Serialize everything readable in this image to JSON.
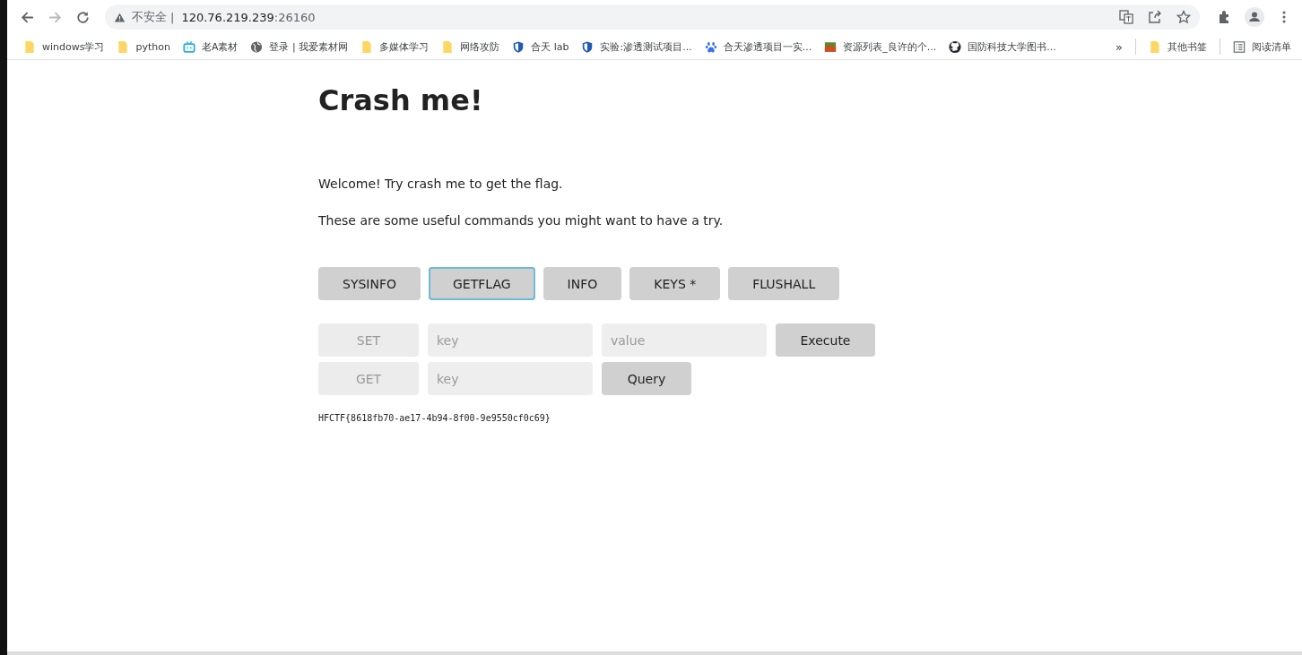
{
  "address_bar": {
    "security_label": "不安全",
    "separator": "|",
    "host": "120.76.219.239",
    "port": ":26160"
  },
  "bookmarks": [
    {
      "kind": "folder",
      "label": "windows学习"
    },
    {
      "kind": "folder",
      "label": "python"
    },
    {
      "kind": "tv",
      "label": "老A素材"
    },
    {
      "kind": "globe",
      "label": "登录 | 我爱素材网"
    },
    {
      "kind": "folder",
      "label": "多媒体学习"
    },
    {
      "kind": "folder",
      "label": "网络攻防"
    },
    {
      "kind": "shield",
      "label": "合天 lab"
    },
    {
      "kind": "shield",
      "label": "实验:渗透测试项目..."
    },
    {
      "kind": "paw",
      "label": "合天渗透项目一实..."
    },
    {
      "kind": "photo",
      "label": "资源列表_良许的个..."
    },
    {
      "kind": "github",
      "label": "国防科技大学图书..."
    }
  ],
  "bookmarks_overflow": "»",
  "other_bookmarks": {
    "kind": "folder",
    "label": "其他书签"
  },
  "reading_list": "阅读清单",
  "page": {
    "title": "Crash me!",
    "paragraphs": [
      "Welcome! Try crash me to get the flag.",
      "These are some useful commands you might want to have a try."
    ],
    "command_buttons": [
      {
        "label": "SYSINFO",
        "focused": false
      },
      {
        "label": "GETFLAG",
        "focused": true
      },
      {
        "label": "INFO",
        "focused": false
      },
      {
        "label": "KEYS *",
        "focused": false
      },
      {
        "label": "FLUSHALL",
        "focused": false
      }
    ],
    "set_row": {
      "command": "SET",
      "key_placeholder": "key",
      "value_placeholder": "value",
      "button": "Execute"
    },
    "get_row": {
      "command": "GET",
      "key_placeholder": "key",
      "button": "Query"
    },
    "output": "HFCTF{8618fb70-ae17-4b94-8f00-9e9550cf0c69}"
  }
}
